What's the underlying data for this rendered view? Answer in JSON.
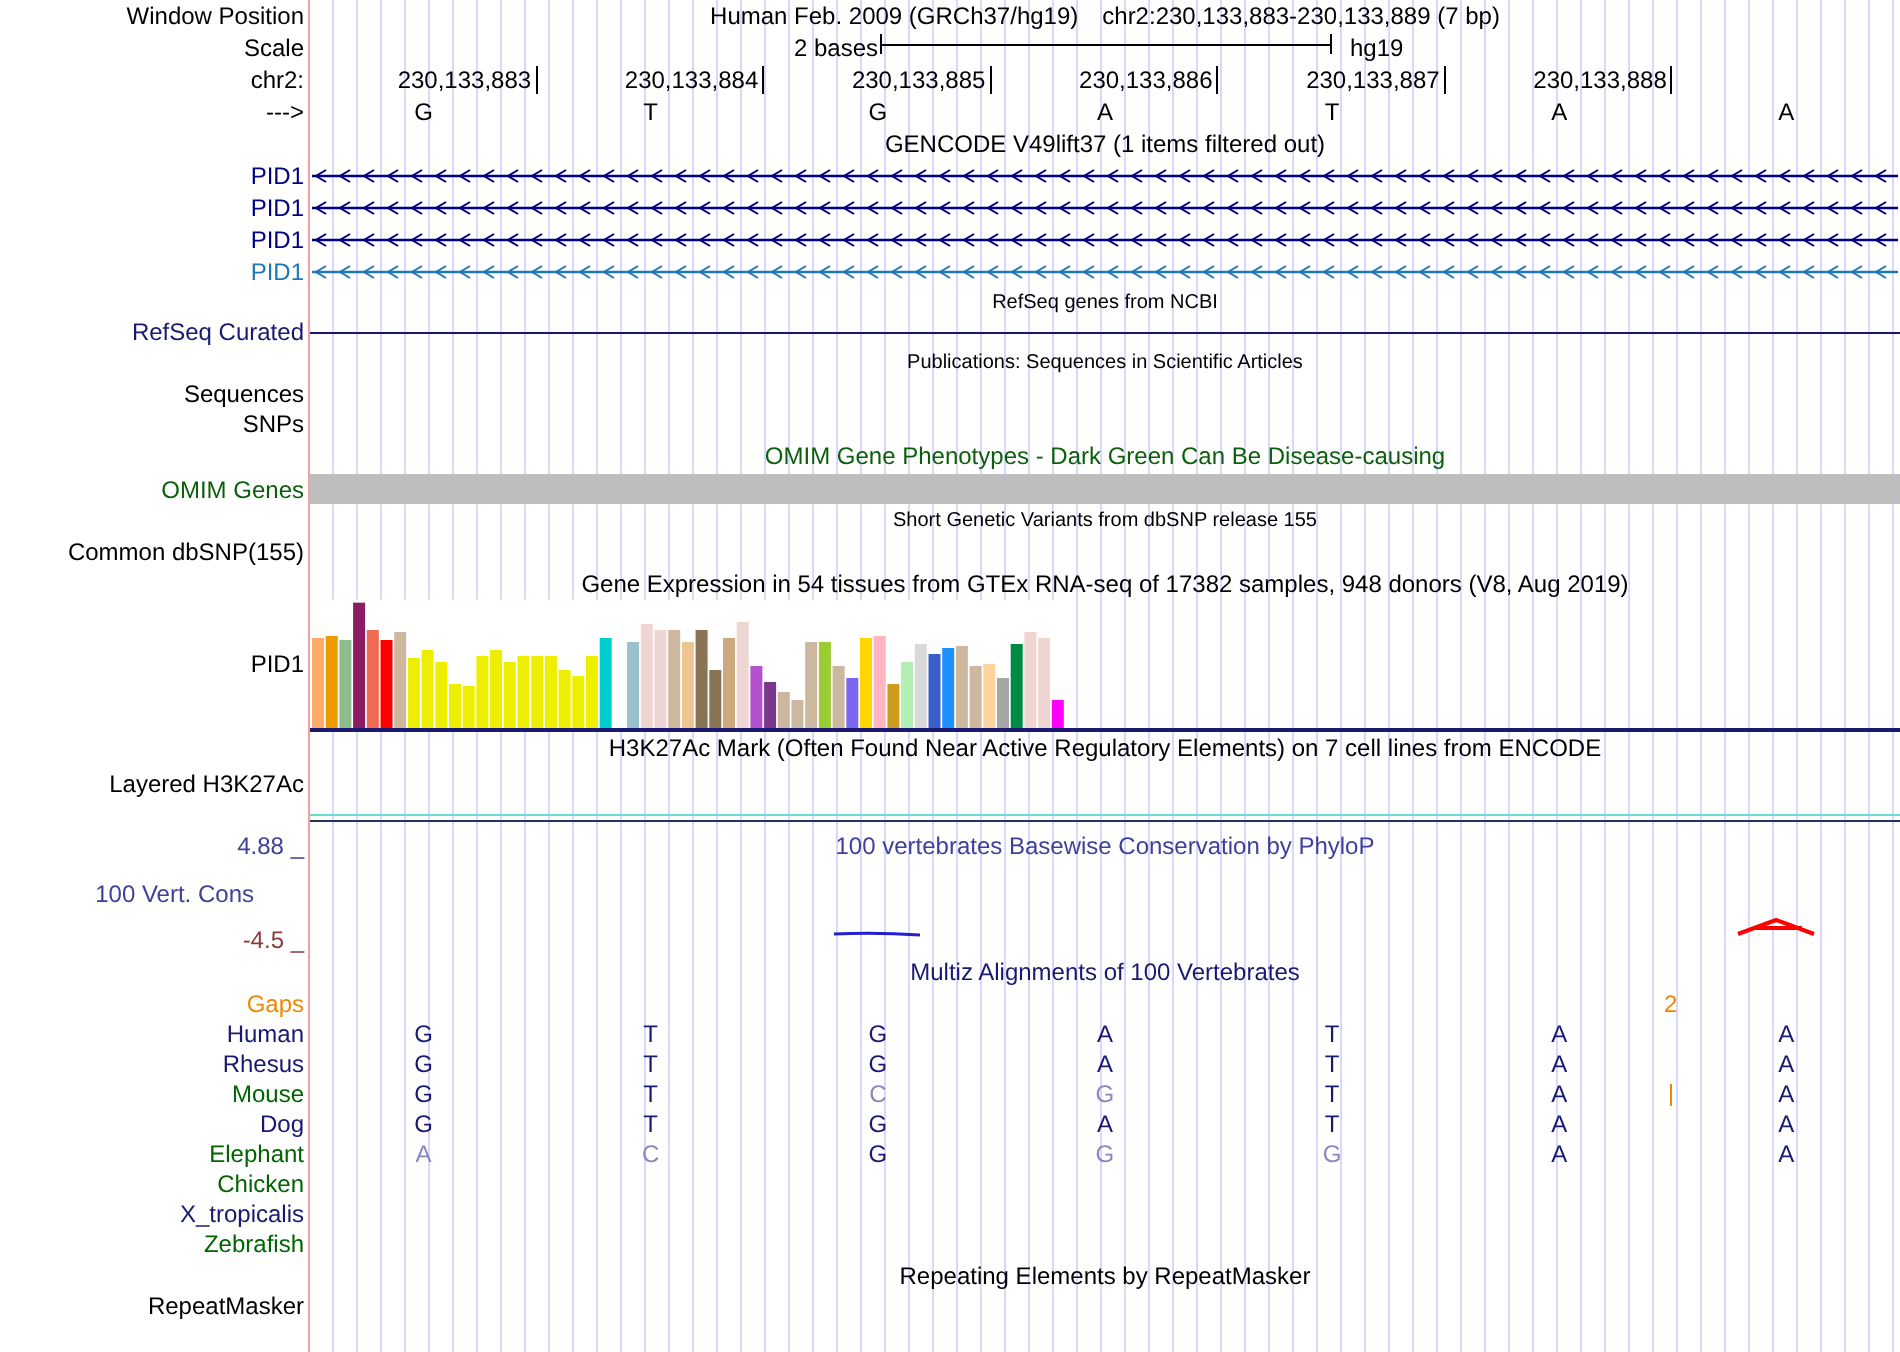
{
  "header": {
    "window_position_label": "Window Position",
    "title": "Human Feb. 2009 (GRCh37/hg19)",
    "position": "chr2:230,133,883-230,133,889 (7 bp)",
    "scale_label": "Scale",
    "scale_text": "2 bases",
    "assembly": "hg19",
    "chrom_label": "chr2:",
    "strand_label": "--->"
  },
  "ruler": [
    "230,133,883",
    "230,133,884",
    "230,133,885",
    "230,133,886",
    "230,133,887",
    "230,133,888"
  ],
  "sequence": [
    "G",
    "T",
    "G",
    "A",
    "T",
    "A",
    "A"
  ],
  "tracks": [
    {
      "kind": "gene",
      "title": "GENCODE V49lift37 (1 items filtered out)",
      "rows": [
        {
          "label": "PID1",
          "color": "#000080"
        },
        {
          "label": "PID1",
          "color": "#000080"
        },
        {
          "label": "PID1",
          "color": "#000080"
        },
        {
          "label": "PID1",
          "color": "#1f77b4"
        }
      ]
    },
    {
      "kind": "line",
      "title": "RefSeq genes from NCBI",
      "label": "RefSeq Curated"
    },
    {
      "kind": "empty",
      "title": "Publications: Sequences in Scientific Articles",
      "labels": [
        "Sequences",
        "SNPs"
      ]
    },
    {
      "kind": "bar",
      "title": "OMIM Gene Phenotypes - Dark Green Can Be Disease-causing",
      "label": "OMIM Genes"
    },
    {
      "kind": "empty",
      "title": "Short Genetic Variants from dbSNP release 155",
      "labels": [
        "Common dbSNP(155)"
      ]
    },
    {
      "kind": "expression",
      "title": "Gene Expression in 54 tissues from GTEx RNA-seq of 17382 samples, 948 donors (V8, Aug 2019)",
      "label": "PID1"
    },
    {
      "kind": "layered",
      "title": "H3K27Ac Mark (Often Found Near Active Regulatory Elements) on 7 cell lines from ENCODE",
      "label": "Layered H3K27Ac"
    },
    {
      "kind": "wiggle",
      "title": "100 vertebrates Basewise Conservation by PhyloP",
      "label": "100 Vert. Cons",
      "max": "4.88 _",
      "min": "-4.5 _"
    },
    {
      "kind": "alignment",
      "title": "Multiz Alignments of 100 Vertebrates",
      "gaps": {
        "label": "Gaps",
        "count": "2"
      },
      "species": [
        {
          "label": "Human",
          "color": "#191970",
          "insertion": false,
          "bases": [
            {
              "base": "G",
              "match": true
            },
            {
              "base": "T",
              "match": true
            },
            {
              "base": "G",
              "match": true
            },
            {
              "base": "A",
              "match": true
            },
            {
              "base": "T",
              "match": true
            },
            {
              "base": "A",
              "match": true
            },
            {
              "base": "A",
              "match": true
            }
          ]
        },
        {
          "label": "Rhesus",
          "color": "#191970",
          "insertion": false,
          "bases": [
            {
              "base": "G",
              "match": true
            },
            {
              "base": "T",
              "match": true
            },
            {
              "base": "G",
              "match": true
            },
            {
              "base": "A",
              "match": true
            },
            {
              "base": "T",
              "match": true
            },
            {
              "base": "A",
              "match": true
            },
            {
              "base": "A",
              "match": true
            }
          ]
        },
        {
          "label": "Mouse",
          "color": "#006400",
          "insertion": true,
          "bases": [
            {
              "base": "G",
              "match": true
            },
            {
              "base": "T",
              "match": true
            },
            {
              "base": "C",
              "match": false
            },
            {
              "base": "G",
              "match": false
            },
            {
              "base": "T",
              "match": true
            },
            {
              "base": "A",
              "match": true
            },
            {
              "base": "A",
              "match": true
            }
          ]
        },
        {
          "label": "Dog",
          "color": "#191970",
          "insertion": false,
          "bases": [
            {
              "base": "G",
              "match": true
            },
            {
              "base": "T",
              "match": true
            },
            {
              "base": "G",
              "match": true
            },
            {
              "base": "A",
              "match": true
            },
            {
              "base": "T",
              "match": true
            },
            {
              "base": "A",
              "match": true
            },
            {
              "base": "A",
              "match": true
            }
          ]
        },
        {
          "label": "Elephant",
          "color": "#006400",
          "insertion": false,
          "bases": [
            {
              "base": "A",
              "match": false
            },
            {
              "base": "C",
              "match": false
            },
            {
              "base": "G",
              "match": true
            },
            {
              "base": "G",
              "match": false
            },
            {
              "base": "G",
              "match": false
            },
            {
              "base": "A",
              "match": true
            },
            {
              "base": "A",
              "match": true
            }
          ]
        },
        {
          "label": "Chicken",
          "color": "#006400",
          "insertion": false
        },
        {
          "label": "X_tropicalis",
          "color": "#191970",
          "insertion": false
        },
        {
          "label": "Zebrafish",
          "color": "#006400",
          "insertion": false
        }
      ]
    },
    {
      "kind": "repeats",
      "title": "Repeating Elements by RepeatMasker",
      "labels": [
        "RepeatMasker"
      ]
    }
  ]
}
